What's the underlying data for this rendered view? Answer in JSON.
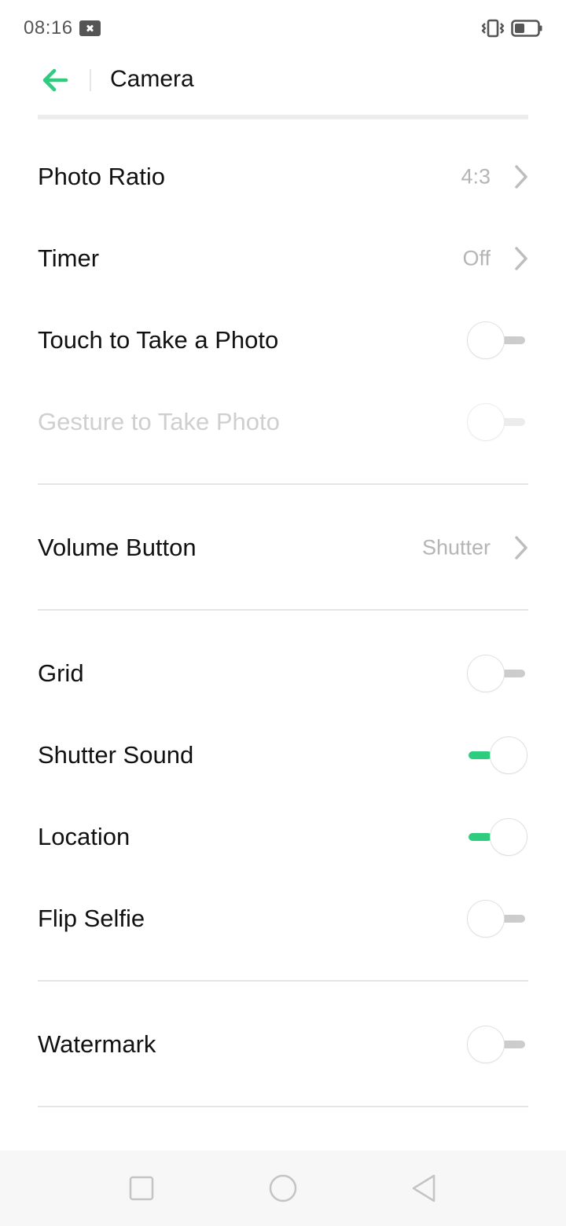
{
  "status_bar": {
    "time": "08:16",
    "icons": [
      "notification-close-icon",
      "vibrate-icon",
      "battery-icon"
    ]
  },
  "header": {
    "title": "Camera",
    "back_icon": "back-arrow-icon",
    "accent_color": "#2ecc7e"
  },
  "settings": {
    "photo_ratio": {
      "label": "Photo Ratio",
      "value": "4:3"
    },
    "timer": {
      "label": "Timer",
      "value": "Off"
    },
    "touch_to_take_photo": {
      "label": "Touch to Take a Photo",
      "enabled": false
    },
    "gesture_to_take_photo": {
      "label": "Gesture to Take Photo",
      "enabled": false,
      "disabled": true
    },
    "volume_button": {
      "label": "Volume Button",
      "value": "Shutter"
    },
    "grid": {
      "label": "Grid",
      "enabled": false
    },
    "shutter_sound": {
      "label": "Shutter Sound",
      "enabled": true
    },
    "location": {
      "label": "Location",
      "enabled": true
    },
    "flip_selfie": {
      "label": "Flip Selfie",
      "enabled": false
    },
    "watermark": {
      "label": "Watermark",
      "enabled": false
    }
  },
  "nav_bar": {
    "buttons": [
      "recent-apps-icon",
      "home-icon",
      "back-icon"
    ]
  }
}
